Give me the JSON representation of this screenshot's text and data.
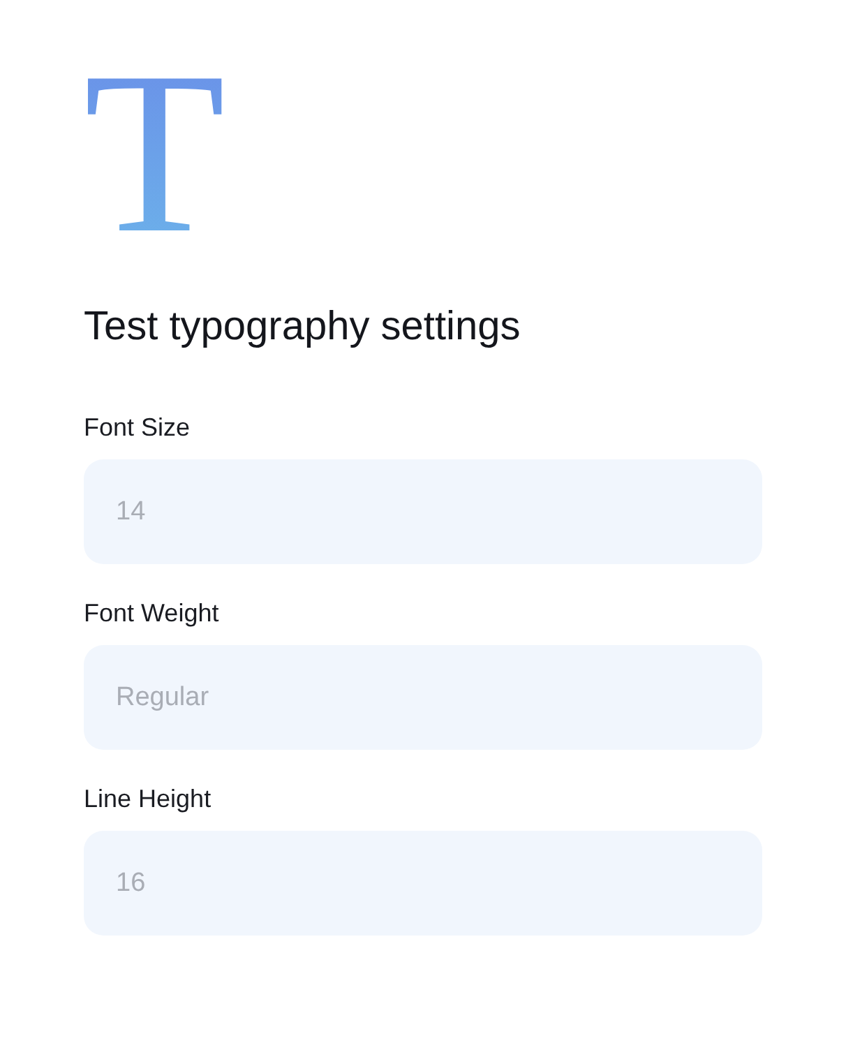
{
  "logo": "T",
  "title": "Test typography settings",
  "fields": [
    {
      "label": "Font Size",
      "placeholder": "14"
    },
    {
      "label": "Font Weight",
      "placeholder": "Regular"
    },
    {
      "label": "Line Height",
      "placeholder": "16"
    }
  ]
}
